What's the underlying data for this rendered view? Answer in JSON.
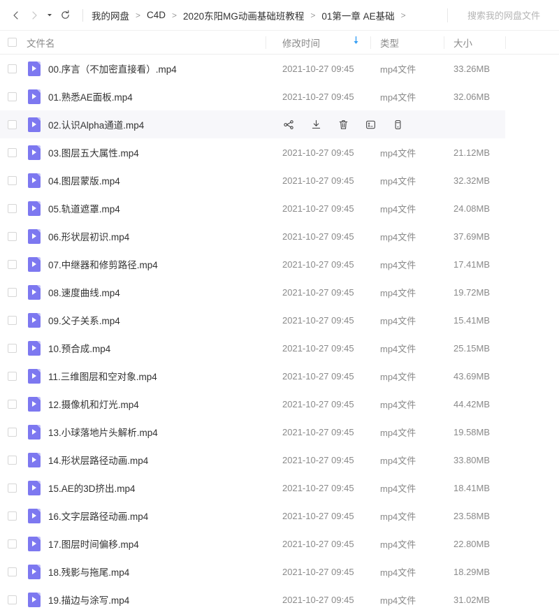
{
  "topbar": {
    "back_icon": "chevron-left-icon",
    "forward_icon": "chevron-right-icon",
    "dropdown_icon": "caret-down-icon",
    "refresh_icon": "refresh-icon",
    "breadcrumb": [
      "我的网盘",
      "C4D",
      "2020东阳MG动画基础班教程",
      "01第一章 AE基础"
    ],
    "breadcrumb_separator": ">",
    "breadcrumb_trailing": ">",
    "search_placeholder": "搜索我的网盘文件",
    "search_value": ""
  },
  "table": {
    "columns": {
      "name": "文件名",
      "time": "修改时间",
      "type": "类型",
      "size": "大小"
    },
    "sort_arrow": "↓",
    "sort_color": "#2f9bf3",
    "hovered_row_index": 2,
    "hover_actions": [
      {
        "name": "share-icon",
        "label": "分享"
      },
      {
        "name": "download-icon",
        "label": "下载"
      },
      {
        "name": "delete-icon",
        "label": "删除"
      },
      {
        "name": "rename-icon",
        "label": "重命名"
      },
      {
        "name": "more-icon",
        "label": "更多"
      }
    ],
    "rows": [
      {
        "name": "00.序言（不加密直接看）.mp4",
        "time": "2021-10-27 09:45",
        "type": "mp4文件",
        "size": "33.26MB"
      },
      {
        "name": "01.熟悉AE面板.mp4",
        "time": "2021-10-27 09:45",
        "type": "mp4文件",
        "size": "32.06MB"
      },
      {
        "name": "02.认识Alpha通道.mp4",
        "time": "2021-10-27 09:45",
        "type": "mp4文件",
        "size": ""
      },
      {
        "name": "03.图层五大属性.mp4",
        "time": "2021-10-27 09:45",
        "type": "mp4文件",
        "size": "21.12MB"
      },
      {
        "name": "04.图层蒙版.mp4",
        "time": "2021-10-27 09:45",
        "type": "mp4文件",
        "size": "32.32MB"
      },
      {
        "name": "05.轨道遮罩.mp4",
        "time": "2021-10-27 09:45",
        "type": "mp4文件",
        "size": "24.08MB"
      },
      {
        "name": "06.形状层初识.mp4",
        "time": "2021-10-27 09:45",
        "type": "mp4文件",
        "size": "37.69MB"
      },
      {
        "name": "07.中继器和修剪路径.mp4",
        "time": "2021-10-27 09:45",
        "type": "mp4文件",
        "size": "17.41MB"
      },
      {
        "name": "08.速度曲线.mp4",
        "time": "2021-10-27 09:45",
        "type": "mp4文件",
        "size": "19.72MB"
      },
      {
        "name": "09.父子关系.mp4",
        "time": "2021-10-27 09:45",
        "type": "mp4文件",
        "size": "15.41MB"
      },
      {
        "name": "10.预合成.mp4",
        "time": "2021-10-27 09:45",
        "type": "mp4文件",
        "size": "25.15MB"
      },
      {
        "name": "11.三维图层和空对象.mp4",
        "time": "2021-10-27 09:45",
        "type": "mp4文件",
        "size": "43.69MB"
      },
      {
        "name": "12.摄像机和灯光.mp4",
        "time": "2021-10-27 09:45",
        "type": "mp4文件",
        "size": "44.42MB"
      },
      {
        "name": "13.小球落地片头解析.mp4",
        "time": "2021-10-27 09:45",
        "type": "mp4文件",
        "size": "19.58MB"
      },
      {
        "name": "14.形状层路径动画.mp4",
        "time": "2021-10-27 09:45",
        "type": "mp4文件",
        "size": "33.80MB"
      },
      {
        "name": "15.AE的3D挤出.mp4",
        "time": "2021-10-27 09:45",
        "type": "mp4文件",
        "size": "18.41MB"
      },
      {
        "name": "16.文字层路径动画.mp4",
        "time": "2021-10-27 09:45",
        "type": "mp4文件",
        "size": "23.58MB"
      },
      {
        "name": "17.图层时间偏移.mp4",
        "time": "2021-10-27 09:45",
        "type": "mp4文件",
        "size": "22.80MB"
      },
      {
        "name": "18.残影与拖尾.mp4",
        "time": "2021-10-27 09:45",
        "type": "mp4文件",
        "size": "18.29MB"
      },
      {
        "name": "19.描边与涂写.mp4",
        "time": "2021-10-27 09:45",
        "type": "mp4文件",
        "size": "31.02MB"
      }
    ]
  },
  "colors": {
    "file_icon": "#7d78f0",
    "accent": "#2f9bf3",
    "hover_row": "#f7f7fa"
  }
}
